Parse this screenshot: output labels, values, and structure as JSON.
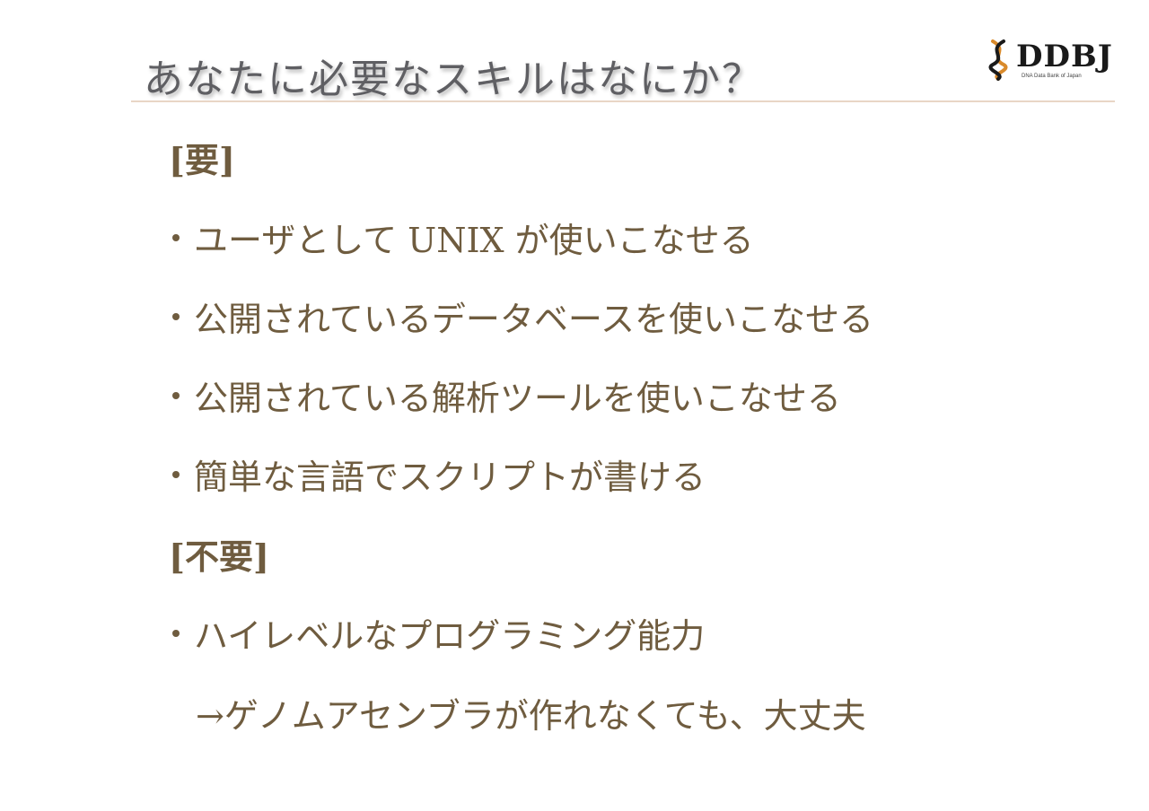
{
  "slide": {
    "title": "あなたに必要なスキルはなにか？",
    "logo": {
      "text": "DDBJ",
      "subtitle": "DNA Data Bank of Japan"
    },
    "sections": [
      {
        "heading": "[要]",
        "items": [
          "ユーザとして UNIX が使いこなせる",
          "公開されているデータベースを使いこなせる",
          "公開されている解析ツールを使いこなせる",
          "簡単な言語でスクリプトが書ける"
        ]
      },
      {
        "heading": "[不要]",
        "items": [
          "ハイレベルなプログラミング能力"
        ],
        "note": "→ゲノムアセンブラが作れなくても、大丈夫"
      }
    ]
  },
  "colors": {
    "text": "#6f5c3f",
    "title": "#5f5f63",
    "rule": "#e9d6c6",
    "background": "#ffffff"
  }
}
